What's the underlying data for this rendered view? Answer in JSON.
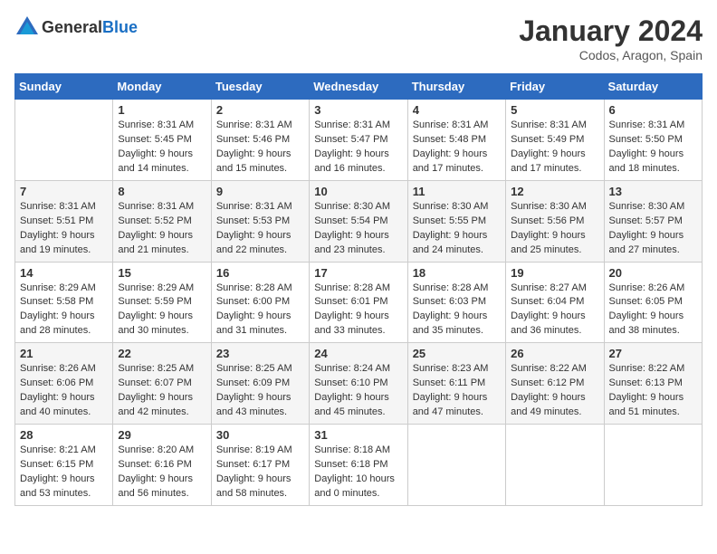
{
  "logo": {
    "general": "General",
    "blue": "Blue"
  },
  "header": {
    "month": "January 2024",
    "location": "Codos, Aragon, Spain"
  },
  "days_of_week": [
    "Sunday",
    "Monday",
    "Tuesday",
    "Wednesday",
    "Thursday",
    "Friday",
    "Saturday"
  ],
  "weeks": [
    [
      {
        "day": "",
        "sunrise": "",
        "sunset": "",
        "daylight": ""
      },
      {
        "day": "1",
        "sunrise": "Sunrise: 8:31 AM",
        "sunset": "Sunset: 5:45 PM",
        "daylight": "Daylight: 9 hours and 14 minutes."
      },
      {
        "day": "2",
        "sunrise": "Sunrise: 8:31 AM",
        "sunset": "Sunset: 5:46 PM",
        "daylight": "Daylight: 9 hours and 15 minutes."
      },
      {
        "day": "3",
        "sunrise": "Sunrise: 8:31 AM",
        "sunset": "Sunset: 5:47 PM",
        "daylight": "Daylight: 9 hours and 16 minutes."
      },
      {
        "day": "4",
        "sunrise": "Sunrise: 8:31 AM",
        "sunset": "Sunset: 5:48 PM",
        "daylight": "Daylight: 9 hours and 17 minutes."
      },
      {
        "day": "5",
        "sunrise": "Sunrise: 8:31 AM",
        "sunset": "Sunset: 5:49 PM",
        "daylight": "Daylight: 9 hours and 17 minutes."
      },
      {
        "day": "6",
        "sunrise": "Sunrise: 8:31 AM",
        "sunset": "Sunset: 5:50 PM",
        "daylight": "Daylight: 9 hours and 18 minutes."
      }
    ],
    [
      {
        "day": "7",
        "sunrise": "Sunrise: 8:31 AM",
        "sunset": "Sunset: 5:51 PM",
        "daylight": "Daylight: 9 hours and 19 minutes."
      },
      {
        "day": "8",
        "sunrise": "Sunrise: 8:31 AM",
        "sunset": "Sunset: 5:52 PM",
        "daylight": "Daylight: 9 hours and 21 minutes."
      },
      {
        "day": "9",
        "sunrise": "Sunrise: 8:31 AM",
        "sunset": "Sunset: 5:53 PM",
        "daylight": "Daylight: 9 hours and 22 minutes."
      },
      {
        "day": "10",
        "sunrise": "Sunrise: 8:30 AM",
        "sunset": "Sunset: 5:54 PM",
        "daylight": "Daylight: 9 hours and 23 minutes."
      },
      {
        "day": "11",
        "sunrise": "Sunrise: 8:30 AM",
        "sunset": "Sunset: 5:55 PM",
        "daylight": "Daylight: 9 hours and 24 minutes."
      },
      {
        "day": "12",
        "sunrise": "Sunrise: 8:30 AM",
        "sunset": "Sunset: 5:56 PM",
        "daylight": "Daylight: 9 hours and 25 minutes."
      },
      {
        "day": "13",
        "sunrise": "Sunrise: 8:30 AM",
        "sunset": "Sunset: 5:57 PM",
        "daylight": "Daylight: 9 hours and 27 minutes."
      }
    ],
    [
      {
        "day": "14",
        "sunrise": "Sunrise: 8:29 AM",
        "sunset": "Sunset: 5:58 PM",
        "daylight": "Daylight: 9 hours and 28 minutes."
      },
      {
        "day": "15",
        "sunrise": "Sunrise: 8:29 AM",
        "sunset": "Sunset: 5:59 PM",
        "daylight": "Daylight: 9 hours and 30 minutes."
      },
      {
        "day": "16",
        "sunrise": "Sunrise: 8:28 AM",
        "sunset": "Sunset: 6:00 PM",
        "daylight": "Daylight: 9 hours and 31 minutes."
      },
      {
        "day": "17",
        "sunrise": "Sunrise: 8:28 AM",
        "sunset": "Sunset: 6:01 PM",
        "daylight": "Daylight: 9 hours and 33 minutes."
      },
      {
        "day": "18",
        "sunrise": "Sunrise: 8:28 AM",
        "sunset": "Sunset: 6:03 PM",
        "daylight": "Daylight: 9 hours and 35 minutes."
      },
      {
        "day": "19",
        "sunrise": "Sunrise: 8:27 AM",
        "sunset": "Sunset: 6:04 PM",
        "daylight": "Daylight: 9 hours and 36 minutes."
      },
      {
        "day": "20",
        "sunrise": "Sunrise: 8:26 AM",
        "sunset": "Sunset: 6:05 PM",
        "daylight": "Daylight: 9 hours and 38 minutes."
      }
    ],
    [
      {
        "day": "21",
        "sunrise": "Sunrise: 8:26 AM",
        "sunset": "Sunset: 6:06 PM",
        "daylight": "Daylight: 9 hours and 40 minutes."
      },
      {
        "day": "22",
        "sunrise": "Sunrise: 8:25 AM",
        "sunset": "Sunset: 6:07 PM",
        "daylight": "Daylight: 9 hours and 42 minutes."
      },
      {
        "day": "23",
        "sunrise": "Sunrise: 8:25 AM",
        "sunset": "Sunset: 6:09 PM",
        "daylight": "Daylight: 9 hours and 43 minutes."
      },
      {
        "day": "24",
        "sunrise": "Sunrise: 8:24 AM",
        "sunset": "Sunset: 6:10 PM",
        "daylight": "Daylight: 9 hours and 45 minutes."
      },
      {
        "day": "25",
        "sunrise": "Sunrise: 8:23 AM",
        "sunset": "Sunset: 6:11 PM",
        "daylight": "Daylight: 9 hours and 47 minutes."
      },
      {
        "day": "26",
        "sunrise": "Sunrise: 8:22 AM",
        "sunset": "Sunset: 6:12 PM",
        "daylight": "Daylight: 9 hours and 49 minutes."
      },
      {
        "day": "27",
        "sunrise": "Sunrise: 8:22 AM",
        "sunset": "Sunset: 6:13 PM",
        "daylight": "Daylight: 9 hours and 51 minutes."
      }
    ],
    [
      {
        "day": "28",
        "sunrise": "Sunrise: 8:21 AM",
        "sunset": "Sunset: 6:15 PM",
        "daylight": "Daylight: 9 hours and 53 minutes."
      },
      {
        "day": "29",
        "sunrise": "Sunrise: 8:20 AM",
        "sunset": "Sunset: 6:16 PM",
        "daylight": "Daylight: 9 hours and 56 minutes."
      },
      {
        "day": "30",
        "sunrise": "Sunrise: 8:19 AM",
        "sunset": "Sunset: 6:17 PM",
        "daylight": "Daylight: 9 hours and 58 minutes."
      },
      {
        "day": "31",
        "sunrise": "Sunrise: 8:18 AM",
        "sunset": "Sunset: 6:18 PM",
        "daylight": "Daylight: 10 hours and 0 minutes."
      },
      {
        "day": "",
        "sunrise": "",
        "sunset": "",
        "daylight": ""
      },
      {
        "day": "",
        "sunrise": "",
        "sunset": "",
        "daylight": ""
      },
      {
        "day": "",
        "sunrise": "",
        "sunset": "",
        "daylight": ""
      }
    ]
  ]
}
